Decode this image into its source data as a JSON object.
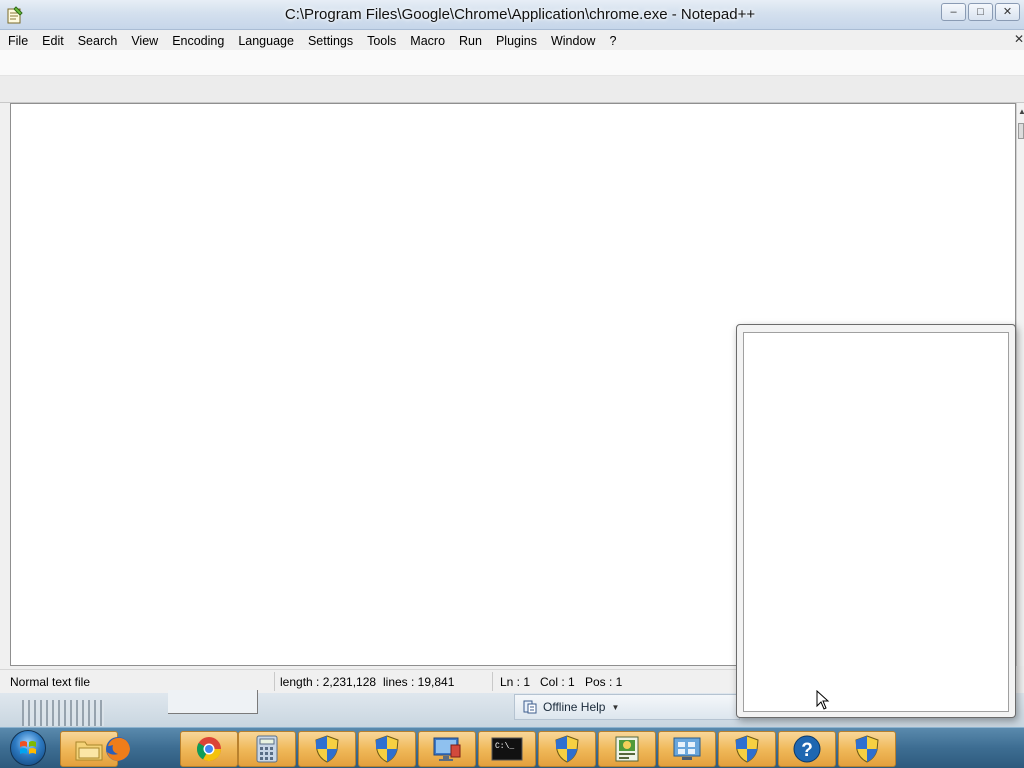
{
  "window": {
    "title": "C:\\Program Files\\Google\\Chrome\\Application\\chrome.exe - Notepad++",
    "minimize_label": "–",
    "maximize_label": "□",
    "close_label": "✕"
  },
  "menu": {
    "items": [
      "File",
      "Edit",
      "Search",
      "View",
      "Encoding",
      "Language",
      "Settings",
      "Tools",
      "Macro",
      "Run",
      "Plugins",
      "Window",
      "?"
    ],
    "close_doc_label": "✕"
  },
  "status": {
    "file_type": "Normal text file",
    "length": "length : 2,231,128",
    "lines": "lines : 19,841",
    "ln": "Ln : 1",
    "col": "Col : 1",
    "pos": "Pos : 1"
  },
  "offline_help": {
    "label": "Offline Help",
    "caret": "▼"
  },
  "taskbar": {
    "items": [
      "start-orb",
      "windows-explorer",
      "firefox",
      "chrome",
      "calculator",
      "uac-shield",
      "uac-shield",
      "remote-desktop",
      "command-prompt",
      "uac-shield",
      "control-panel-app",
      "network-settings",
      "uac-shield",
      "help",
      "uac-shield"
    ],
    "cmd_text": "C:\\_"
  },
  "colors": {
    "taskbar_active": "#f0b95a",
    "titlebar": "#d4e0ee",
    "editor_bg": "#ffffff"
  }
}
